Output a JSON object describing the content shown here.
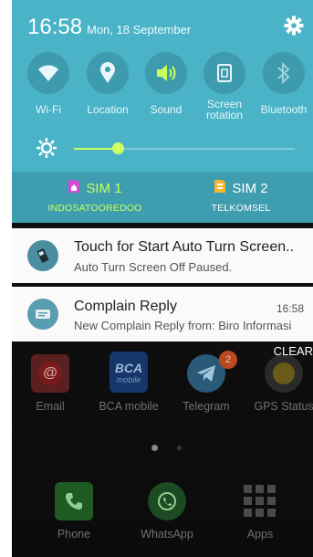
{
  "status": {
    "time": "16:58",
    "date": "Mon, 18 September"
  },
  "quick_settings": [
    {
      "label": "Wi-Fi",
      "icon": "wifi-icon"
    },
    {
      "label": "Location",
      "icon": "location-pin-icon"
    },
    {
      "label": "Sound",
      "icon": "speaker-icon"
    },
    {
      "label": "Screen\nrotation",
      "icon": "screen-rotation-icon"
    },
    {
      "label": "Bluetooth",
      "icon": "bluetooth-icon"
    }
  ],
  "brightness": {
    "level": 0.2
  },
  "sims": [
    {
      "name": "SIM 1",
      "carrier": "INDOSATOOREDOO",
      "color": "#c8ff5a",
      "icon_color": "#d14ad8"
    },
    {
      "name": "SIM 2",
      "carrier": "TELKOMSEL",
      "color": "#ffffff",
      "icon_color": "#f6b52f"
    }
  ],
  "notifications": [
    {
      "title": "Touch for Start Auto Turn Screen..",
      "subtitle": "Auto Turn Screen Off Paused.",
      "time": ""
    },
    {
      "title": "Complain Reply",
      "subtitle": "New Complain Reply from: Biro Informasi",
      "time": "16:58"
    }
  ],
  "clear_label": "CLEAR",
  "apps_row1": [
    {
      "label": "Email"
    },
    {
      "label": "BCA mobile",
      "icon_text": "BCA",
      "icon_sub": "mobile"
    },
    {
      "label": "Telegram",
      "badge": "2"
    },
    {
      "label": "GPS Status"
    }
  ],
  "dock": [
    {
      "label": "Phone"
    },
    {
      "label": "WhatsApp"
    },
    {
      "label": "Apps"
    }
  ],
  "colors": {
    "panel": "#4ab3c7",
    "panel_dark": "#3f9db0",
    "accent": "#c8ff5a"
  }
}
